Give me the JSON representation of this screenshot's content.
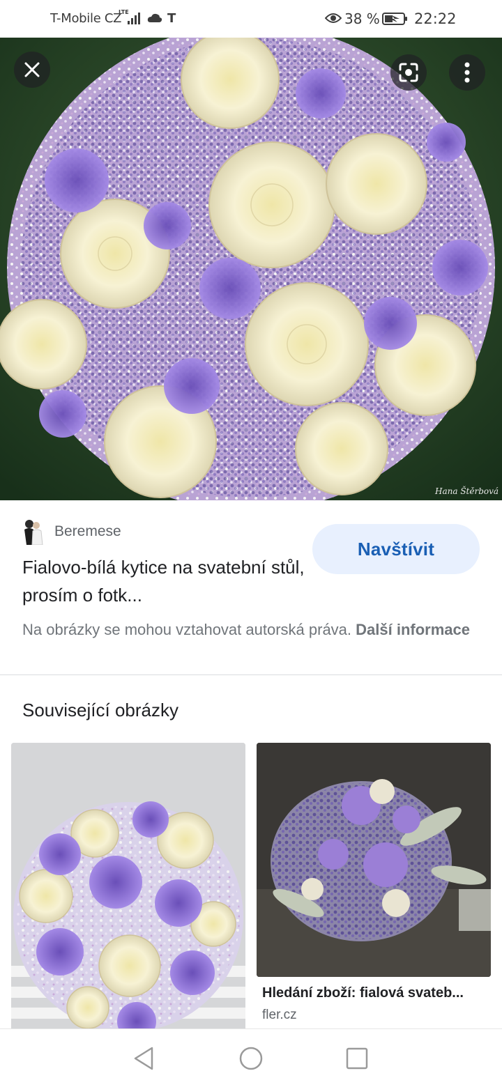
{
  "status_bar": {
    "carrier": "T-Mobile CZ",
    "network": "LTE",
    "operator_logo": "T",
    "battery_percent": "38 %",
    "time": "22:22"
  },
  "hero": {
    "watermark": "Hana Štěrbová",
    "buttons": {
      "close": "close-icon",
      "lens": "google-lens-icon",
      "more": "more-vert-icon"
    }
  },
  "result": {
    "source_name": "Beremese",
    "title": "Fialovo-bílá kytice na svatební stůl, prosím o fotk...",
    "visit_label": "Navštívit",
    "copyright_text": "Na obrázky se mohou vztahovat autorská práva.",
    "copyright_link": "Další informace"
  },
  "related": {
    "heading": "Související obrázky",
    "items": [
      {
        "caption": "",
        "site": ""
      },
      {
        "caption": "Hledání zboží: fialová svateb...",
        "site": "fler.cz"
      }
    ]
  },
  "colors": {
    "accent": "#1a5fb4",
    "visit_bg": "#e8f0fe",
    "rose": "#f6f1cf",
    "violet": "#8c6fd6",
    "lavender": "#5b4aa6"
  }
}
